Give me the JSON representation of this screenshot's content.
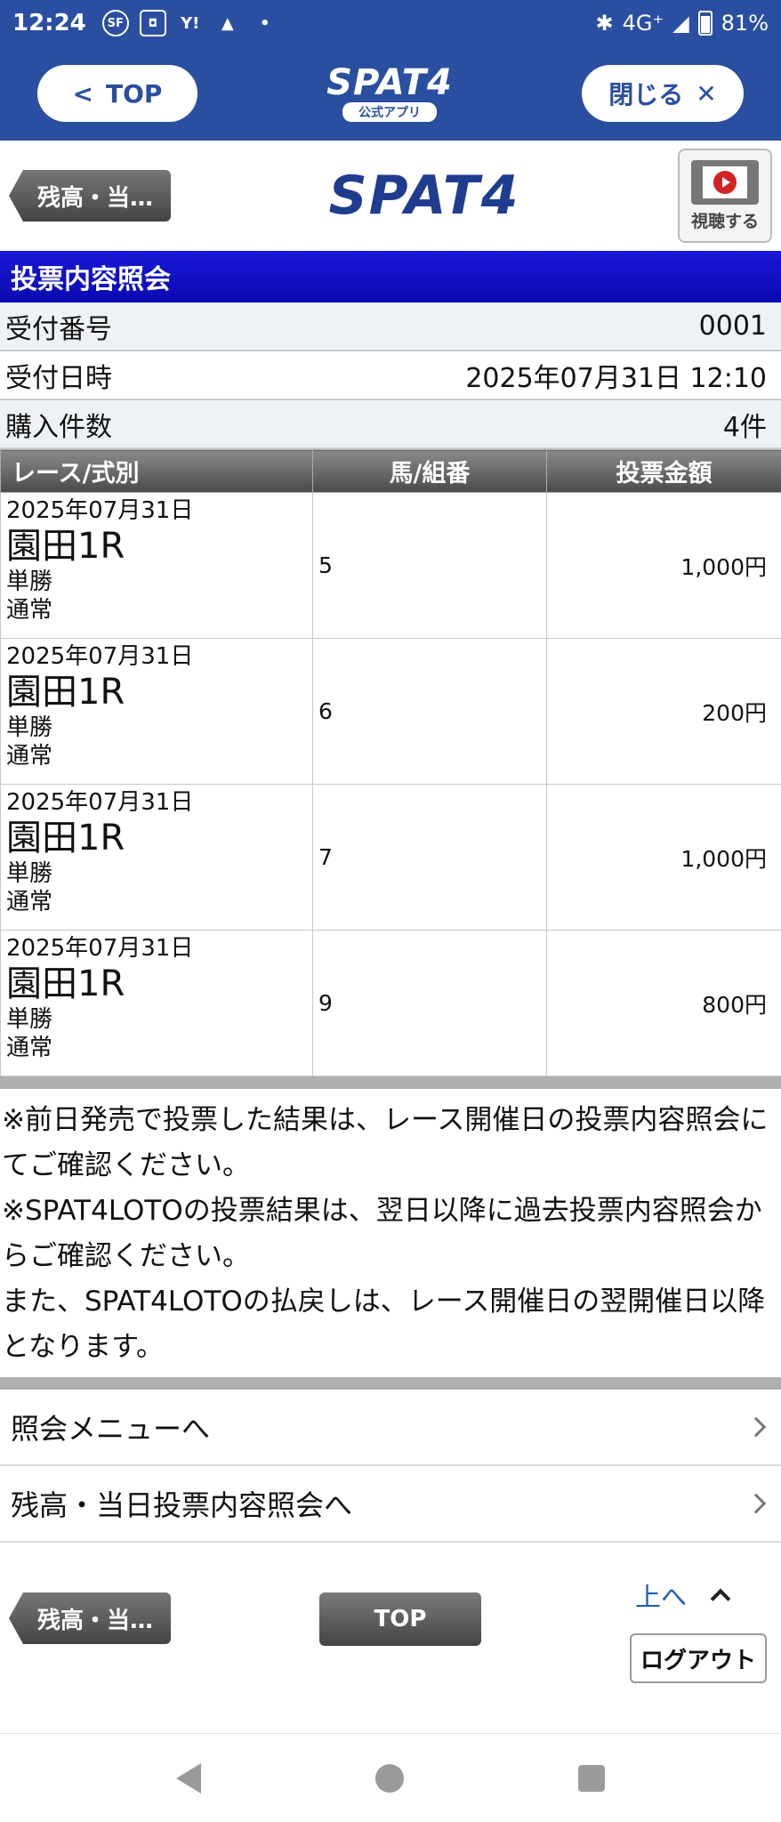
{
  "status_bar": {
    "time": "12:24",
    "network": "4G⁺",
    "battery": "81%"
  },
  "app_header": {
    "top_label": "TOP",
    "logo": "SPAT4",
    "logo_sub": "公式アプリ",
    "close_label": "閉じる"
  },
  "content_header": {
    "back_label": "残高・当…",
    "logo": "SPAT4",
    "watch_label": "視聴する"
  },
  "section_title": "投票内容照会",
  "info": [
    {
      "label": "受付番号",
      "value": "0001"
    },
    {
      "label": "受付日時",
      "value": "2025年07月31日 12:10"
    },
    {
      "label": "購入件数",
      "value": "4件"
    }
  ],
  "table": {
    "headers": [
      "レース/式別",
      "馬/組番",
      "投票金額"
    ],
    "rows": [
      {
        "date": "2025年07月31日",
        "race": "園田1R",
        "type": "単勝",
        "mode": "通常",
        "number": "5",
        "amount": "1,000円"
      },
      {
        "date": "2025年07月31日",
        "race": "園田1R",
        "type": "単勝",
        "mode": "通常",
        "number": "6",
        "amount": "200円"
      },
      {
        "date": "2025年07月31日",
        "race": "園田1R",
        "type": "単勝",
        "mode": "通常",
        "number": "7",
        "amount": "1,000円"
      },
      {
        "date": "2025年07月31日",
        "race": "園田1R",
        "type": "単勝",
        "mode": "通常",
        "number": "9",
        "amount": "800円"
      }
    ]
  },
  "notes": [
    "※前日発売で投票した結果は、レース開催日の投票内容照会にてご確認ください。",
    "※SPAT4LOTOの投票結果は、翌日以降に過去投票内容照会からご確認ください。",
    "また、SPAT4LOTOの払戻しは、レース開催日の翌開催日以降となります。"
  ],
  "menu": [
    {
      "label": "照会メニューへ"
    },
    {
      "label": "残高・当日投票内容照会へ"
    }
  ],
  "footer": {
    "back_label": "残高・当…",
    "top_label": "TOP",
    "up_label": "上へ",
    "logout_label": "ログアウト"
  }
}
